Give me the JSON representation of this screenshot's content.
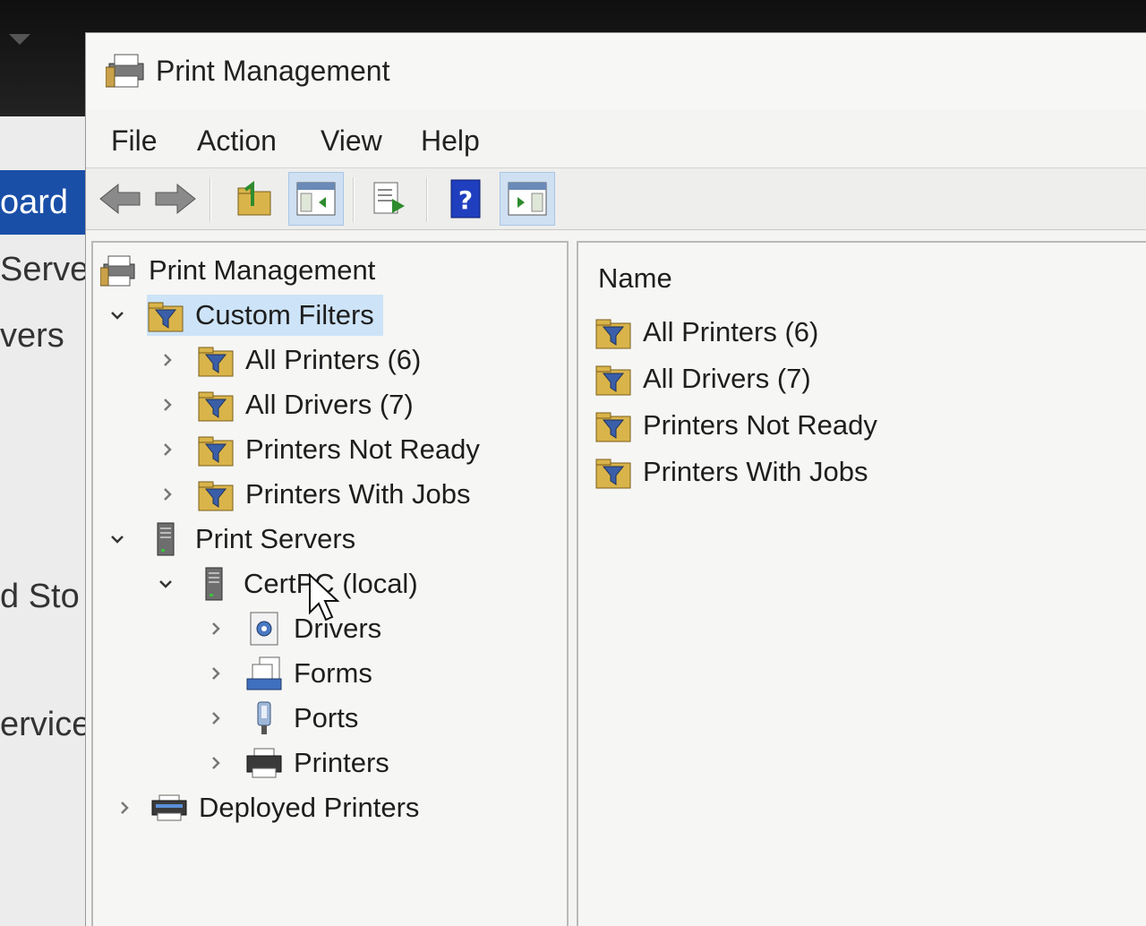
{
  "background_app": {
    "nav_items": [
      {
        "label": "oard",
        "selected": true
      },
      {
        "label": "Server",
        "selected": false
      },
      {
        "label": "vers",
        "selected": false
      },
      {
        "label": "d Sto",
        "selected": false
      },
      {
        "label": "ervice",
        "selected": false
      }
    ]
  },
  "window": {
    "title": "Print Management"
  },
  "menu": {
    "items": [
      "File",
      "Action",
      "View",
      "Help"
    ]
  },
  "toolbar": {
    "buttons": [
      {
        "icon": "back-arrow-icon",
        "active": false
      },
      {
        "icon": "forward-arrow-icon",
        "active": false
      },
      {
        "icon": "up-folder-icon",
        "active": false
      },
      {
        "icon": "show-hide-console-tree-icon",
        "active": true
      },
      {
        "icon": "export-list-icon",
        "active": false
      },
      {
        "icon": "help-icon",
        "active": false
      },
      {
        "icon": "show-hide-action-pane-icon",
        "active": true
      }
    ]
  },
  "tree": {
    "root": "Print Management",
    "custom_filters": "Custom Filters",
    "all_printers": "All Printers (6)",
    "all_drivers": "All Drivers (7)",
    "printers_not_ready": "Printers Not Ready",
    "printers_with_jobs": "Printers With Jobs",
    "print_servers": "Print Servers",
    "server_name": "CertPC (local)",
    "drivers": "Drivers",
    "forms": "Forms",
    "ports": "Ports",
    "printers": "Printers",
    "deployed_printers": "Deployed Printers"
  },
  "list": {
    "column_name": "Name",
    "rows": [
      "All Printers (6)",
      "All Drivers (7)",
      "Printers Not Ready",
      "Printers With Jobs"
    ]
  },
  "colors": {
    "selection": "#cde3f7",
    "accent": "#1a4fa8",
    "folder": "#d9b44a"
  }
}
